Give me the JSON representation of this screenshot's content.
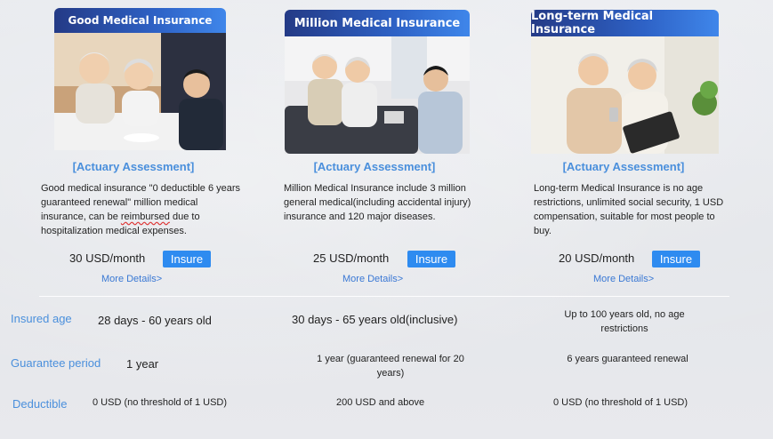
{
  "plans": [
    {
      "name": "Good Medical Insurance",
      "assessment": "[Actuary Assessment]",
      "description_pre": "Good medical insurance \"0 deductible 6 years guaranteed renewal\" million medical insurance, can be ",
      "description_flag": "reimbursed",
      "description_post": " due to hospitalization medical expenses.",
      "price": "30 USD/month",
      "insure_label": "Insure",
      "more_label": "More Details>"
    },
    {
      "name": "Million Medical Insurance",
      "assessment": "[Actuary Assessment]",
      "description": "Million Medical Insurance include 3 million general medical(including accidental injury) insurance and 120 major diseases.",
      "price": "25 USD/month",
      "insure_label": "Insure",
      "more_label": "More Details>"
    },
    {
      "name": "Long-term Medical Insurance",
      "assessment": "[Actuary Assessment]",
      "description": "Long-term Medical Insurance is no age restrictions, unlimited social security, 1 USD compensation, suitable for most people to buy.",
      "price": "20 USD/month",
      "insure_label": "Insure",
      "more_label": "More Details>"
    }
  ],
  "comparison": {
    "rows": [
      {
        "label": "Insured age",
        "values": [
          "28 days - 60 years old",
          "30 days - 65 years old(inclusive)",
          "Up to 100 years old, no age restrictions"
        ]
      },
      {
        "label": "Guarantee period",
        "values": [
          "1 year",
          "1 year (guaranteed renewal for 20 years)",
          "6 years guaranteed renewal"
        ]
      },
      {
        "label": "Deductible",
        "values": [
          "0 USD (no threshold of 1 USD)",
          "200 USD and above",
          "0 USD (no threshold of 1 USD)"
        ]
      }
    ]
  },
  "colors": {
    "header_gradient_start": "#243a86",
    "header_gradient_end": "#3f86ea",
    "accent_blue": "#4a8fdc",
    "button_blue": "#2e8bf0",
    "link_blue": "#3a78d4"
  }
}
